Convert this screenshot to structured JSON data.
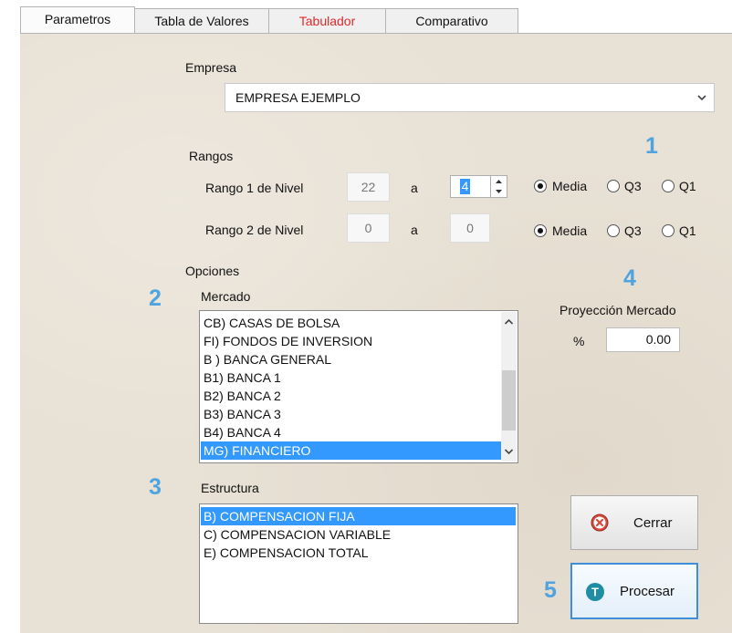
{
  "tabs": [
    {
      "label": "Parametros",
      "active": true
    },
    {
      "label": "Tabla de Valores",
      "active": false
    },
    {
      "label": "Tabulador",
      "active": false,
      "color": "#e0282a"
    },
    {
      "label": "Comparativo",
      "active": false
    }
  ],
  "empresa": {
    "label": "Empresa",
    "value": "EMPRESA EJEMPLO"
  },
  "rangos": {
    "label": "Rangos",
    "rango1": {
      "label": "Rango 1 de Nivel",
      "from": "22",
      "sep": "a",
      "to": "4",
      "options": [
        "Media",
        "Q3",
        "Q1"
      ],
      "selected": "Media"
    },
    "rango2": {
      "label": "Rango 2 de Nivel",
      "from": "0",
      "sep": "a",
      "to": "0",
      "options": [
        "Media",
        "Q3",
        "Q1"
      ],
      "selected": "Media"
    }
  },
  "opciones": {
    "label": "Opciones"
  },
  "mercado": {
    "label": "Mercado",
    "items": [
      "CB) CASAS DE BOLSA",
      "FI) FONDOS DE INVERSION",
      "B ) BANCA GENERAL",
      "B1) BANCA 1",
      "B2) BANCA 2",
      "B3) BANCA 3",
      "B4) BANCA 4",
      "MG) FINANCIERO"
    ],
    "selected": "MG) FINANCIERO"
  },
  "estructura": {
    "label": "Estructura",
    "items": [
      "B) COMPENSACION FIJA",
      "C) COMPENSACION VARIABLE",
      "E) COMPENSACION TOTAL"
    ],
    "selected": "B) COMPENSACION FIJA"
  },
  "proyeccion": {
    "label": "Proyección Mercado",
    "unit": "%",
    "value": "0.00"
  },
  "buttons": {
    "cerrar": "Cerrar",
    "procesar": "Procesar",
    "procesar_icon_letter": "T"
  },
  "markers": [
    "1",
    "2",
    "3",
    "4",
    "5"
  ],
  "colors": {
    "marker": "#4fa4e0",
    "selection": "#3399ff",
    "tab_alert": "#e0282a",
    "panel": "#e8e1d5"
  },
  "icons": {
    "combo_arrow": "chevron-down-icon",
    "cerrar": "close-circle-icon",
    "procesar": "t-circle-icon"
  }
}
